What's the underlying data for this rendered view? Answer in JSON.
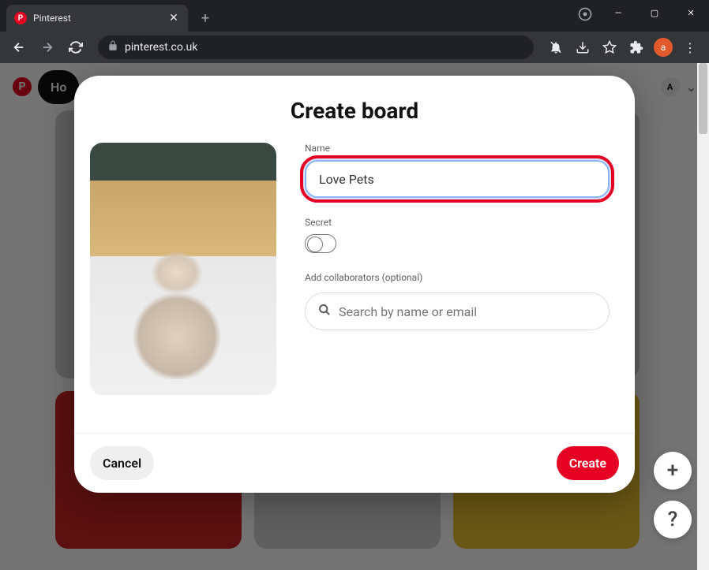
{
  "browser": {
    "tab_title": "Pinterest",
    "address": "pinterest.co.uk",
    "avatar_letter": "a",
    "new_tab_glyph": "+",
    "close_glyph": "✕",
    "minimize_glyph": "—",
    "maximize_glyph": "▢",
    "window_close_glyph": "✕",
    "menu_glyph": "⋮"
  },
  "page": {
    "logo_letter": "P",
    "home_label": "Ho",
    "header_avatar_letter": "A",
    "chevron_glyph": "⌄",
    "fab_plus": "+",
    "fab_help": "?"
  },
  "modal": {
    "title": "Create board",
    "name_label": "Name",
    "name_value": "Love Pets",
    "secret_label": "Secret",
    "collab_label": "Add collaborators (optional)",
    "collab_placeholder": "Search by name or email",
    "cancel_label": "Cancel",
    "create_label": "Create"
  }
}
